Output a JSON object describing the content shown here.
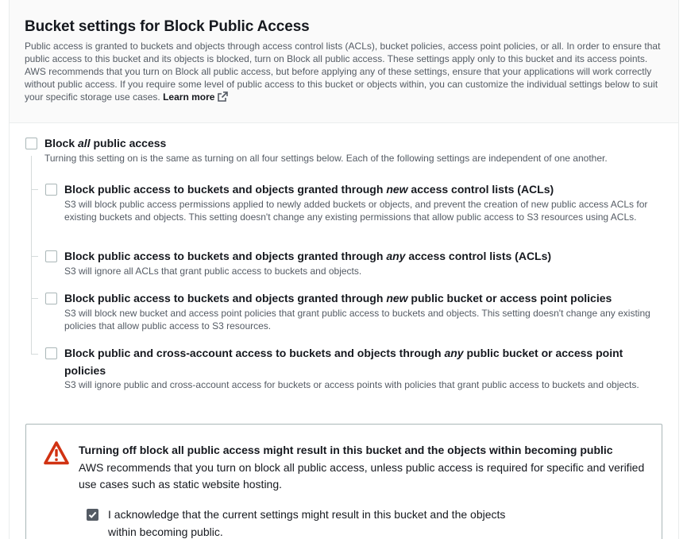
{
  "header": {
    "title": "Bucket settings for Block Public Access",
    "description": "Public access is granted to buckets and objects through access control lists (ACLs), bucket policies, access point policies, or all. In order to ensure that public access to this bucket and its objects is blocked, turn on Block all public access. These settings apply only to this bucket and its access points. AWS recommends that you turn on Block all public access, but before applying any of these settings, ensure that your applications will work correctly without public access. If you require some level of public access to this bucket or objects within, you can customize the individual settings below to suit your specific storage use cases.",
    "learn_more": "Learn more",
    "learn_more_icon": "external-link-icon"
  },
  "block_all": {
    "label_prefix": "Block ",
    "label_emphasis": "all",
    "label_suffix": " public access",
    "description": "Turning this setting on is the same as turning on all four settings below. Each of the following settings are independent of one another.",
    "checked": false
  },
  "options": [
    {
      "title_prefix": "Block public access to buckets and objects granted through ",
      "title_emphasis": "new",
      "title_suffix": " access control lists (ACLs)",
      "description": "S3 will block public access permissions applied to newly added buckets or objects, and prevent the creation of new public access ACLs for existing buckets and objects. This setting doesn't change any existing permissions that allow public access to S3 resources using ACLs.",
      "checked": false
    },
    {
      "title_prefix": "Block public access to buckets and objects granted through ",
      "title_emphasis": "any",
      "title_suffix": " access control lists (ACLs)",
      "description": "S3 will ignore all ACLs that grant public access to buckets and objects.",
      "checked": false
    },
    {
      "title_prefix": "Block public access to buckets and objects granted through ",
      "title_emphasis": "new",
      "title_suffix": " public bucket or access point policies",
      "description": "S3 will block new bucket and access point policies that grant public access to buckets and objects. This setting doesn't change any existing policies that allow public access to S3 resources.",
      "checked": false
    },
    {
      "title_prefix": "Block public and cross-account access to buckets and objects through ",
      "title_emphasis": "any",
      "title_suffix": " public bucket or access point policies",
      "description": "S3 will ignore public and cross-account access for buckets or access points with policies that grant public access to buckets and objects.",
      "checked": false
    }
  ],
  "warning": {
    "icon": "warning-triangle-icon",
    "title": "Turning off block all public access might result in this bucket and the objects within becoming public",
    "body": "AWS recommends that you turn on block all public access, unless public access is required for specific and verified use cases such as static website hosting.",
    "ack_label": "I acknowledge that the current settings might result in this bucket and the objects within becoming public.",
    "ack_checked": true
  },
  "colors": {
    "warning_red": "#d13212",
    "text_primary": "#16191f",
    "text_secondary": "#545b64",
    "border": "#aab7b8"
  }
}
